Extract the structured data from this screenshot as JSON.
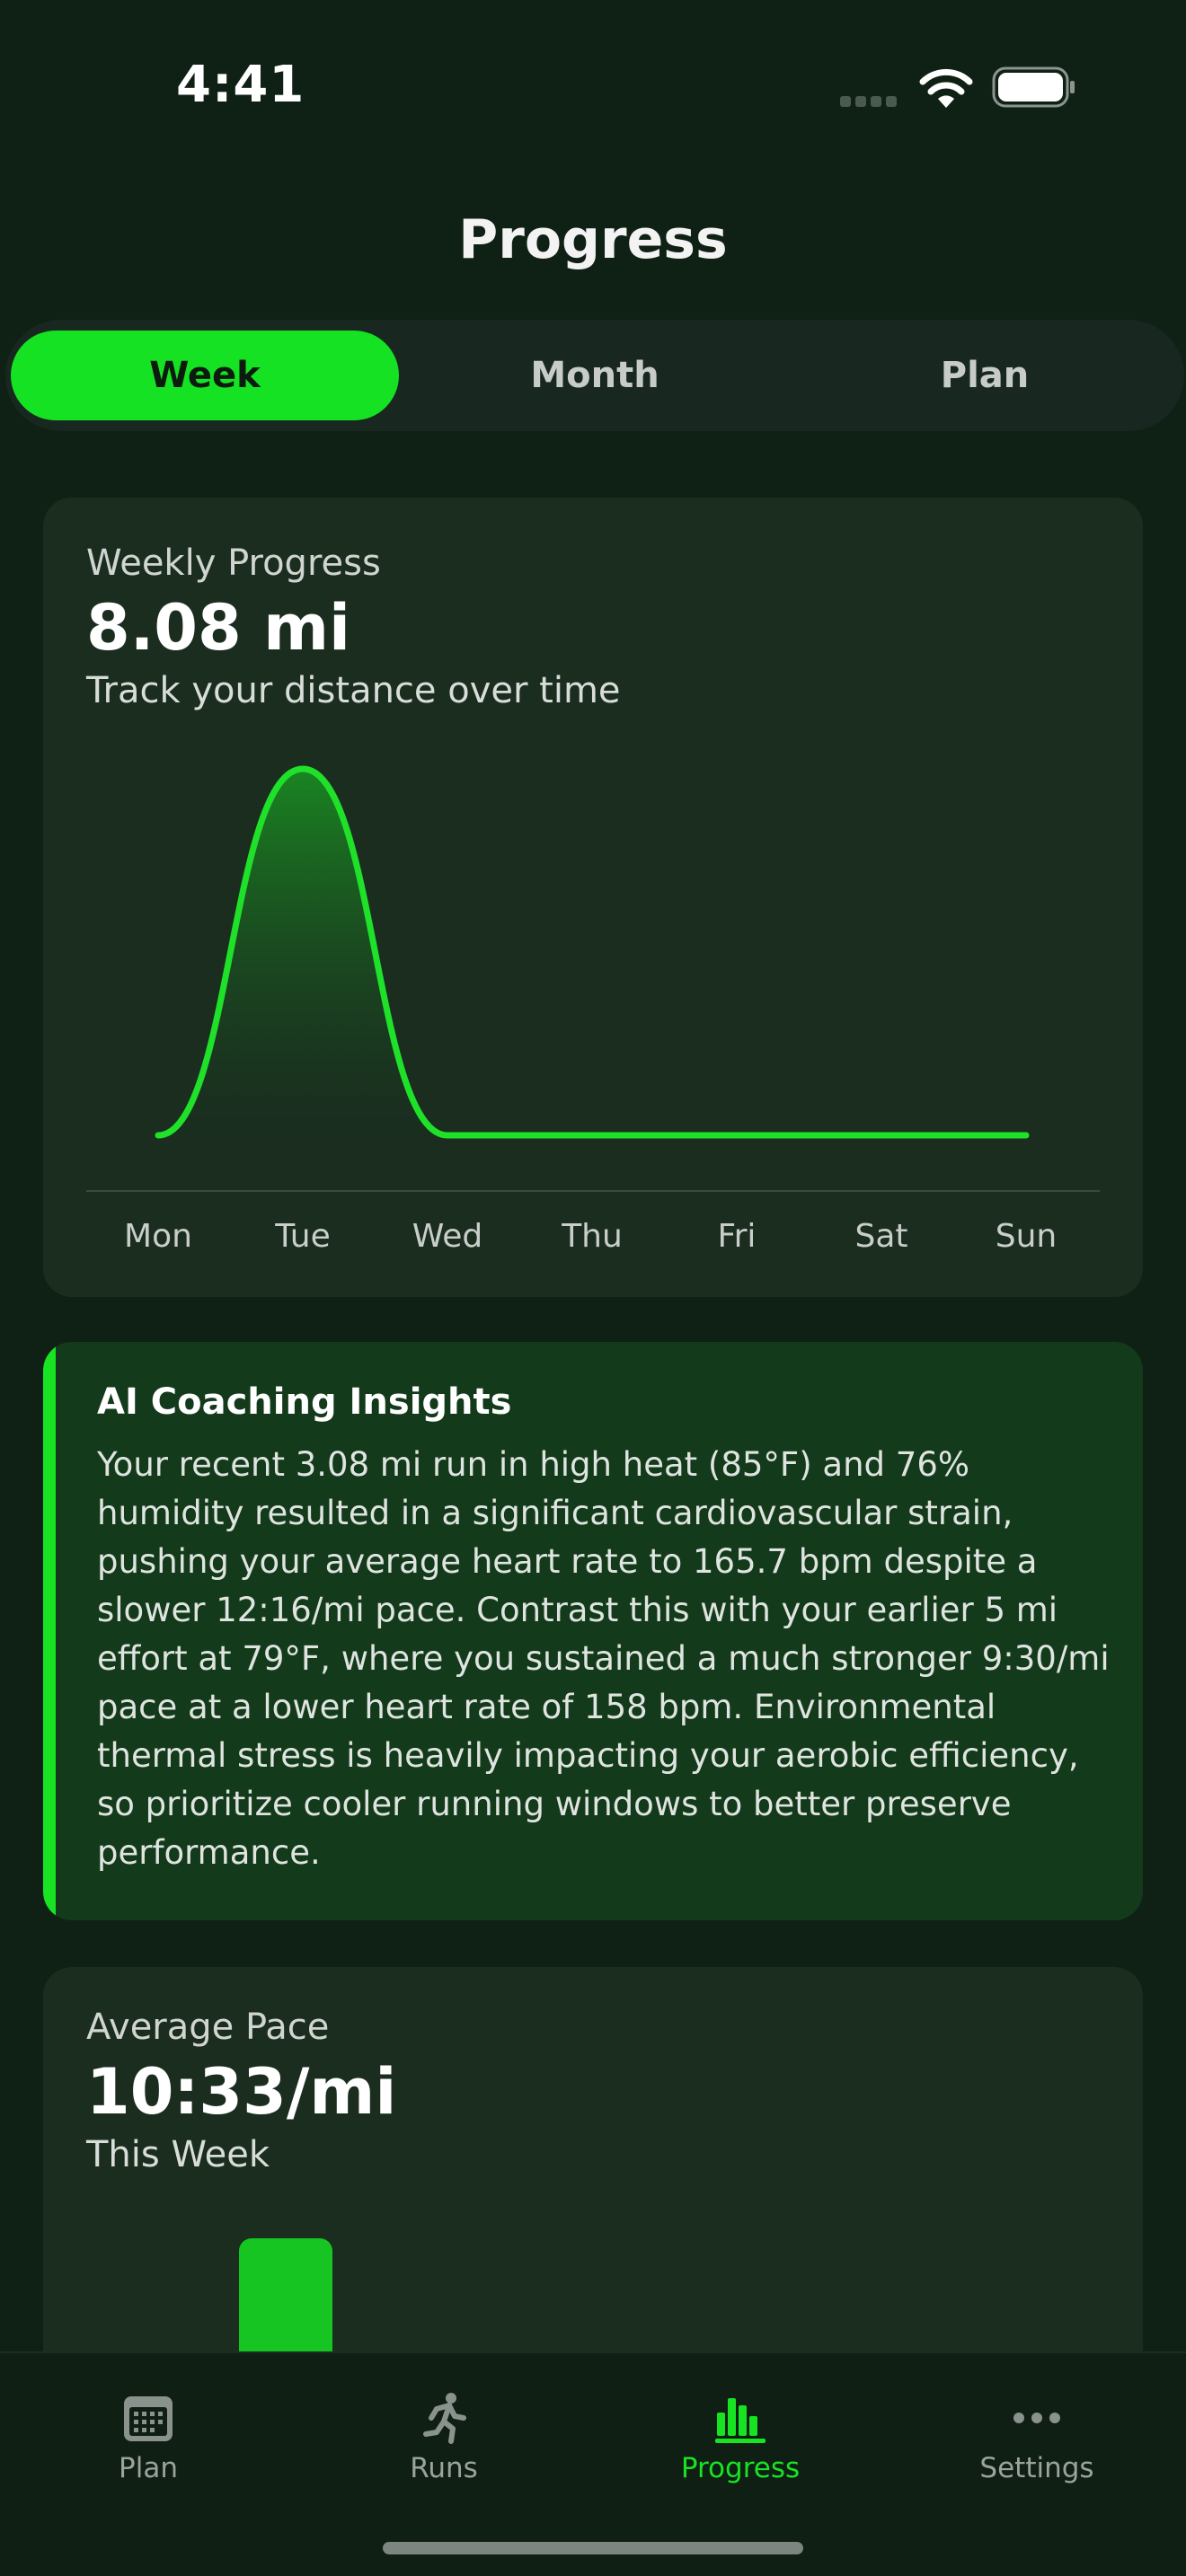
{
  "status": {
    "time": "4:41"
  },
  "header": {
    "title": "Progress"
  },
  "segments": {
    "week": "Week",
    "month": "Month",
    "plan": "Plan",
    "selected": "Week"
  },
  "weekly": {
    "label": "Weekly Progress",
    "value": "8.08 mi",
    "subtitle": "Track your distance over time"
  },
  "chart_data": {
    "type": "area",
    "categories": [
      "Mon",
      "Tue",
      "Wed",
      "Thu",
      "Fri",
      "Sat",
      "Sun"
    ],
    "values": [
      0,
      8.08,
      0,
      0,
      0,
      0,
      0
    ],
    "title": "",
    "xlabel": "",
    "ylabel": "",
    "grid": false,
    "line_color": "#1fe12a"
  },
  "insights": {
    "title": "AI Coaching Insights",
    "body": "Your recent 3.08 mi run in high heat (85°F) and 76% humidity resulted in a significant cardiovascular strain, pushing your average heart rate to 165.7 bpm despite a slower 12:16/mi pace. Contrast this with your earlier 5 mi effort at 79°F, where you sustained a much stronger 9:30/mi pace at a lower heart rate of 158 bpm. Environmental thermal stress is heavily impacting your aerobic efficiency, so prioritize cooler running windows to better preserve performance."
  },
  "pace": {
    "label": "Average Pace",
    "value": "10:33/mi",
    "subtitle": "This Week"
  },
  "tabs": [
    {
      "label": "Plan",
      "icon": "calendar-icon"
    },
    {
      "label": "Runs",
      "icon": "runner-icon"
    },
    {
      "label": "Progress",
      "icon": "bar-chart-icon"
    },
    {
      "label": "Settings",
      "icon": "more-icon"
    }
  ],
  "colors": {
    "accent": "#15e222",
    "background": "#0f2114",
    "card": "#1a2d1f"
  }
}
